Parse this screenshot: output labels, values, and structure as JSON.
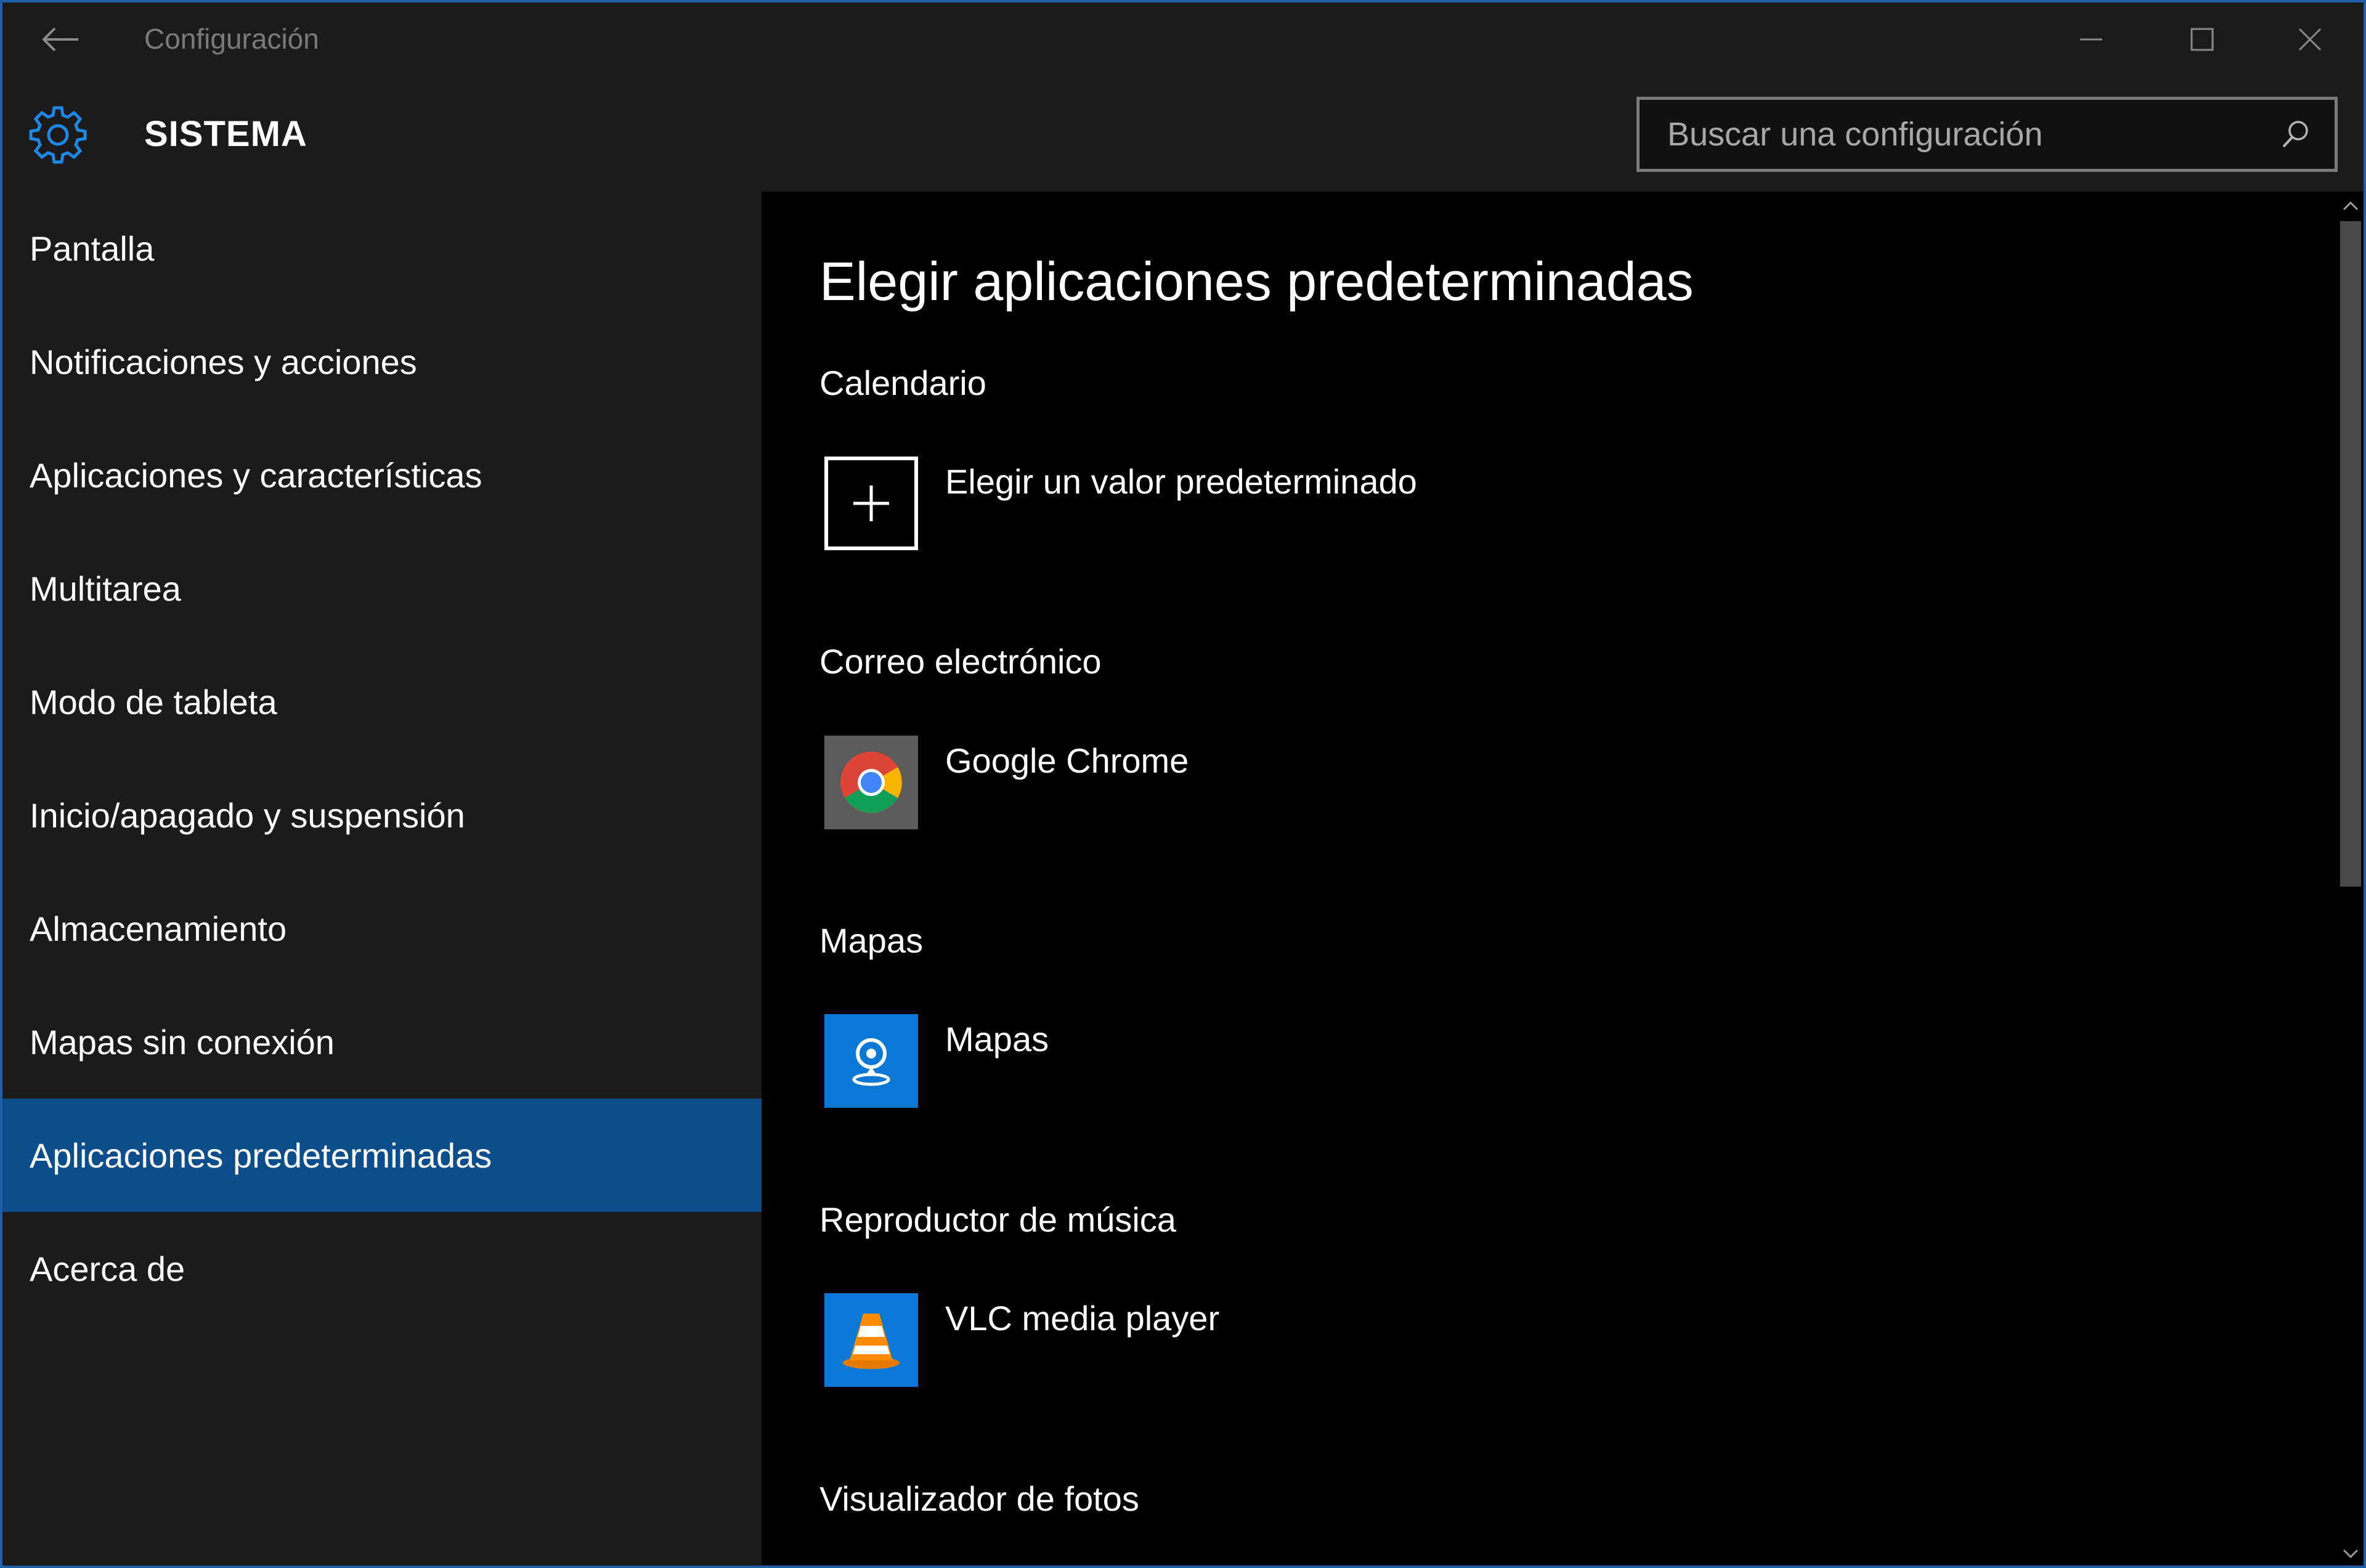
{
  "titlebar": {
    "title": "Configuración",
    "back_icon": "back-arrow-icon",
    "minimize_icon": "minimize-icon",
    "maximize_icon": "maximize-icon",
    "close_icon": "close-icon"
  },
  "header": {
    "section_title": "SISTEMA",
    "section_icon": "gear-icon",
    "accent_color": "#0c4e8c",
    "search": {
      "placeholder": "Buscar una configuración",
      "value": "",
      "icon": "search-icon"
    }
  },
  "sidebar": {
    "items": [
      {
        "label": "Pantalla",
        "selected": false
      },
      {
        "label": "Notificaciones y acciones",
        "selected": false
      },
      {
        "label": "Aplicaciones y características",
        "selected": false
      },
      {
        "label": "Multitarea",
        "selected": false
      },
      {
        "label": "Modo de tableta",
        "selected": false
      },
      {
        "label": "Inicio/apagado y suspensión",
        "selected": false
      },
      {
        "label": "Almacenamiento",
        "selected": false
      },
      {
        "label": "Mapas sin conexión",
        "selected": false
      },
      {
        "label": "Aplicaciones predeterminadas",
        "selected": true
      },
      {
        "label": "Acerca de",
        "selected": false
      }
    ]
  },
  "main": {
    "title": "Elegir aplicaciones predeterminadas",
    "categories": [
      {
        "label": "Calendario",
        "app": "Elegir un valor predeterminado",
        "icon": "plus-icon"
      },
      {
        "label": "Correo electrónico",
        "app": "Google Chrome",
        "icon": "chrome-icon"
      },
      {
        "label": "Mapas",
        "app": "Mapas",
        "icon": "maps-icon"
      },
      {
        "label": "Reproductor de música",
        "app": "VLC media player",
        "icon": "vlc-icon"
      },
      {
        "label": "Visualizador de fotos",
        "app": "",
        "icon": ""
      }
    ]
  }
}
